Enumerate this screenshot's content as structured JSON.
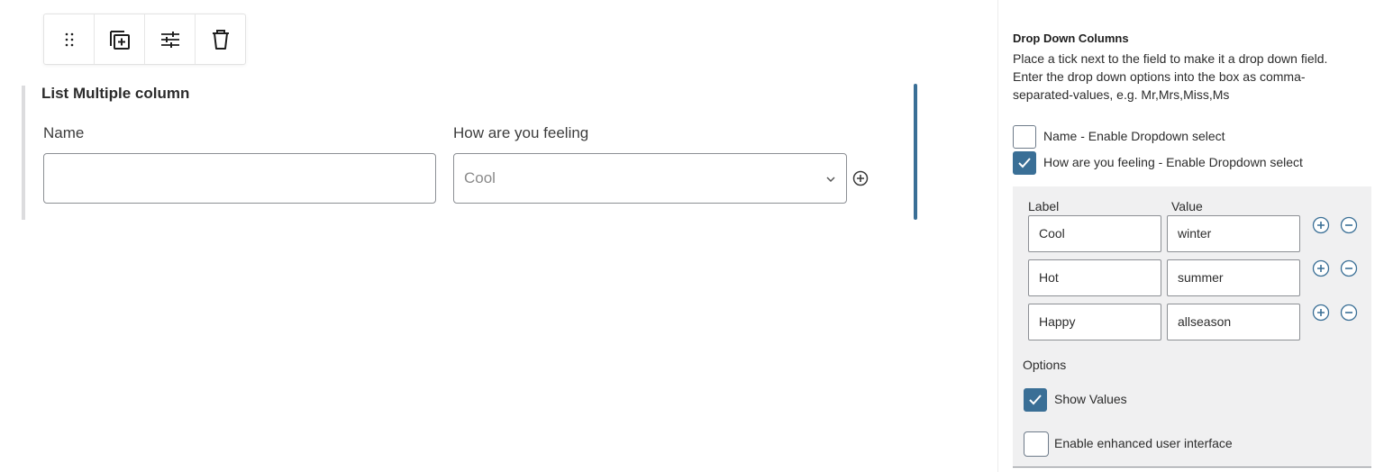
{
  "toolbar": {
    "items": [
      {
        "name": "drag-handle",
        "icon": "drag-handle-icon"
      },
      {
        "name": "duplicate",
        "icon": "duplicate-icon"
      },
      {
        "name": "settings",
        "icon": "sliders-icon"
      },
      {
        "name": "delete",
        "icon": "trash-icon"
      }
    ]
  },
  "block": {
    "title": "List Multiple column",
    "columns": [
      {
        "label": "Name",
        "value": ""
      },
      {
        "label": "How are you feeling",
        "selected": "Cool"
      }
    ]
  },
  "sidebar": {
    "title": "Drop Down Columns",
    "description": "Place a tick next to the field to make it a drop down field. Enter the drop down options into the box as comma-separated-values, e.g. Mr,Mrs,Miss,Ms",
    "dropdown_columns": [
      {
        "label": "Name - Enable Dropdown select",
        "checked": false
      },
      {
        "label": "How are you feeling - Enable Dropdown select",
        "checked": true
      }
    ],
    "table": {
      "label_header": "Label",
      "value_header": "Value",
      "rows": [
        {
          "label": "Cool",
          "value": "winter"
        },
        {
          "label": "Hot",
          "value": "summer"
        },
        {
          "label": "Happy",
          "value": "allseason"
        }
      ]
    },
    "options": {
      "heading": "Options",
      "show_values": {
        "label": "Show Values",
        "checked": true
      },
      "enhanced_ui": {
        "label": "Enable enhanced user interface",
        "checked": false
      }
    }
  },
  "colors": {
    "accent": "#3a6f96",
    "panel_bg": "#f0f0f1",
    "border": "#8c8f94"
  }
}
